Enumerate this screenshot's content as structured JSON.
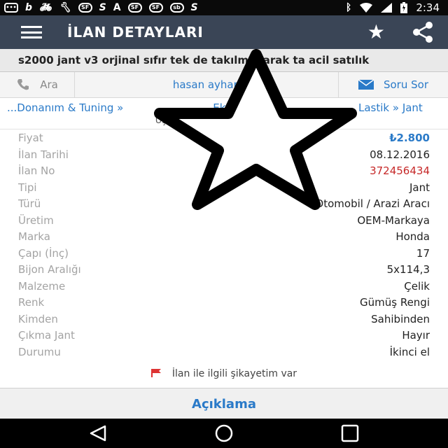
{
  "status_bar": {
    "icons": [
      "messages-icon",
      "b-app-icon",
      "cycling-icon",
      "wrench-icon",
      "sf-app-icon",
      "s-app-icon",
      "a-app-icon",
      "sf-app-icon",
      "sf-app-icon",
      "sahibinden-app-icon",
      "s-app-icon"
    ],
    "time": "2:34"
  },
  "toolbar": {
    "title": "İLAN DETAYLARI"
  },
  "listing": {
    "title": "s2000 jant v3 orjinal sıfır tek de takılm olarak ta acil satılık"
  },
  "actions": {
    "call_label": "Ara",
    "user_name": "hasan ayhan",
    "ask_label": "Soru Sor"
  },
  "breadcrumb": {
    "items": [
      "...Donanım & Tuning »",
      "...Ekipmanları »",
      "Lastik » Jant"
    ]
  },
  "location": "Uşak, Banaz, 31 Ağustos Mah.",
  "details": [
    {
      "label": "Fiyat",
      "value": "₺2.800"
    },
    {
      "label": "İlan Tarihi",
      "value": "08.12.2016"
    },
    {
      "label": "İlan No",
      "value": "372456434"
    },
    {
      "label": "Tipi",
      "value": "Jant"
    },
    {
      "label": "Türü",
      "value": "Otomobil / Arazi Aracı"
    },
    {
      "label": "Üretim",
      "value": "OEM-Markaya"
    },
    {
      "label": "Marka",
      "value": "Honda"
    },
    {
      "label": "Çapı (İnç)",
      "value": "17"
    },
    {
      "label": "Bijon Aralığı",
      "value": "5x114,3"
    },
    {
      "label": "Malzeme",
      "value": "Çelik"
    },
    {
      "label": "Renk",
      "value": "Gümüş Rengi"
    },
    {
      "label": "Kimden",
      "value": "Sahibinden"
    },
    {
      "label": "Çıkma Jant",
      "value": "Hayır"
    },
    {
      "label": "Durumu",
      "value": "İkinci el"
    }
  ],
  "complaint_label": "İlan ile ilgili şikayetim var",
  "description_label": "Açıklama",
  "colors": {
    "toolbar": "#3a4556",
    "accent_blue": "#2a7ac8",
    "listing_no_red": "#c62828"
  }
}
